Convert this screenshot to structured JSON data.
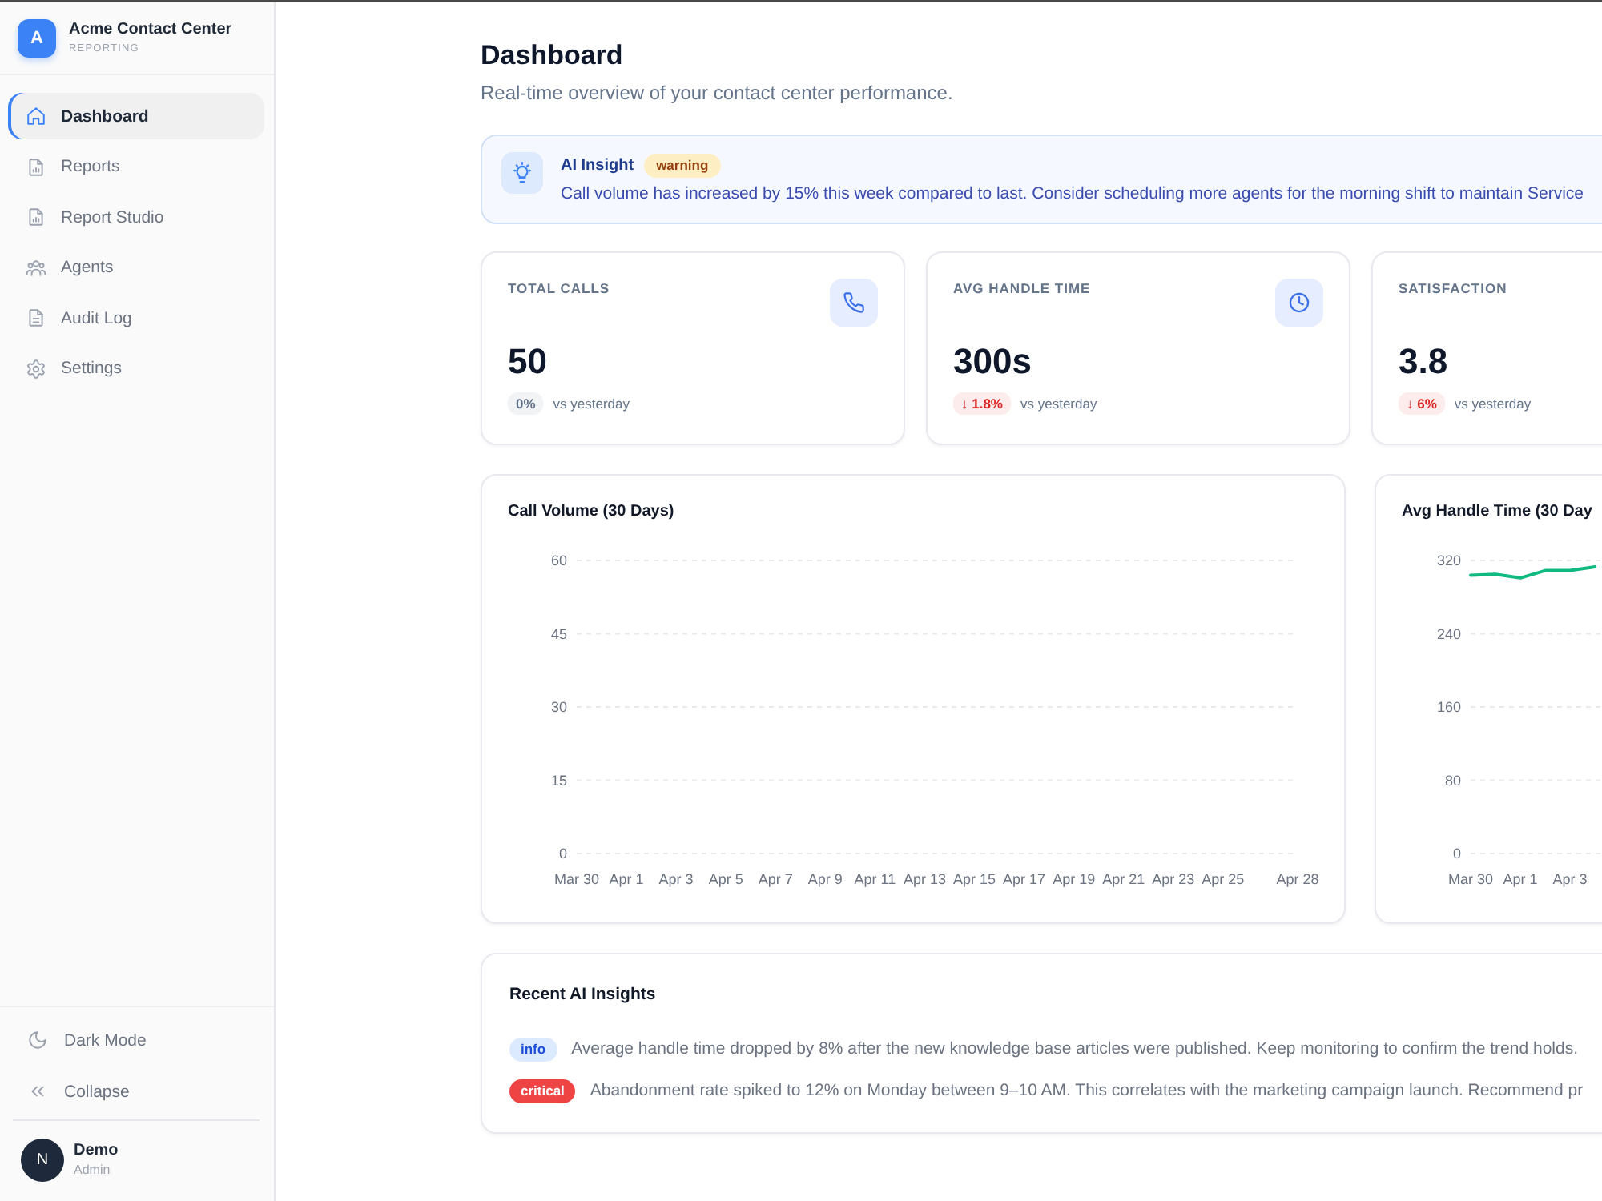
{
  "sidebar": {
    "brand": {
      "logo": "A",
      "name": "Acme Contact Center",
      "subtitle": "REPORTING"
    },
    "nav": [
      {
        "label": "Dashboard",
        "selected": true
      },
      {
        "label": "Reports",
        "selected": false
      },
      {
        "label": "Report Studio",
        "selected": false
      },
      {
        "label": "Agents",
        "selected": false
      },
      {
        "label": "Audit Log",
        "selected": false
      },
      {
        "label": "Settings",
        "selected": false
      }
    ],
    "footer": [
      {
        "label": "Dark Mode"
      },
      {
        "label": "Collapse"
      }
    ],
    "user": {
      "initial": "N",
      "name": "Demo",
      "role": "Admin"
    }
  },
  "header": {
    "title": "Dashboard",
    "subtitle": "Real-time overview of your contact center performance."
  },
  "insight_banner": {
    "title": "AI Insight",
    "badge": "warning",
    "kind": "warning",
    "text": "Call volume has increased by 15% this week compared to last. Consider scheduling more agents for the morning shift to maintain Service"
  },
  "stats": [
    {
      "label": "TOTAL CALLS",
      "value": "50",
      "change": "0%",
      "color": "#64748b",
      "note": "vs yesterday"
    },
    {
      "label": "AVG HANDLE TIME",
      "value": "300s",
      "change": "↓ 1.8%",
      "color": "#dc2626",
      "note": "vs yesterday"
    },
    {
      "label": "SATISFACTION",
      "value": "3.8",
      "change": "↓ 6%",
      "color": "#dc2626",
      "note": "vs yesterday"
    }
  ],
  "charts": [
    {
      "chart_data": {
        "type": "line",
        "title": "Call Volume (30 Days)",
        "ylim": [
          0,
          60
        ],
        "grid": true,
        "categories": [
          "Mar 30",
          null,
          "Apr 1",
          null,
          "Apr 3",
          null,
          "Apr 5",
          null,
          "Apr 7",
          null,
          "Apr 9",
          null,
          "Apr 11",
          null,
          "Apr 13",
          null,
          "Apr 15",
          null,
          "Apr 17",
          null,
          "Apr 19",
          null,
          "Apr 21",
          null,
          "Apr 23",
          null,
          "Apr 25",
          null,
          null,
          "Apr 28"
        ],
        "yticks": [
          0,
          15,
          30,
          45,
          60
        ]
      }
    },
    {
      "chart_data": {
        "type": "line",
        "title": "Avg Handle Time (30 Day",
        "ylim": [
          0,
          320
        ],
        "grid": true,
        "categories": [
          "Mar 30",
          null,
          "Apr 1",
          null,
          "Apr 3",
          null,
          null,
          null,
          null,
          null,
          null,
          null,
          null,
          null,
          null,
          null,
          null,
          null,
          null,
          null,
          null,
          null,
          null,
          null,
          null,
          null,
          null,
          null,
          null,
          null
        ],
        "yticks": [
          0,
          80,
          160,
          240,
          320
        ],
        "series": [
          {
            "color": "#10b981",
            "values": [
              304,
              305,
              301,
              309,
              309,
              313,
              null,
              null,
              null,
              null,
              null,
              null,
              null,
              null,
              null,
              null,
              null,
              null,
              null,
              null,
              null,
              null,
              null,
              null,
              null,
              null,
              null,
              null,
              null,
              null
            ]
          }
        ]
      }
    }
  ],
  "recent_insights": {
    "title": "Recent AI Insights",
    "items": [
      {
        "kind": "info",
        "badge": "info",
        "text": "Average handle time dropped by 8% after the new knowledge base articles were published. Keep monitoring to confirm the trend holds."
      },
      {
        "kind": "critical",
        "badge": "critical",
        "text": "Abandonment rate spiked to 12% on Monday between 9–10 AM. This correlates with the marketing campaign launch. Recommend pr"
      }
    ]
  }
}
